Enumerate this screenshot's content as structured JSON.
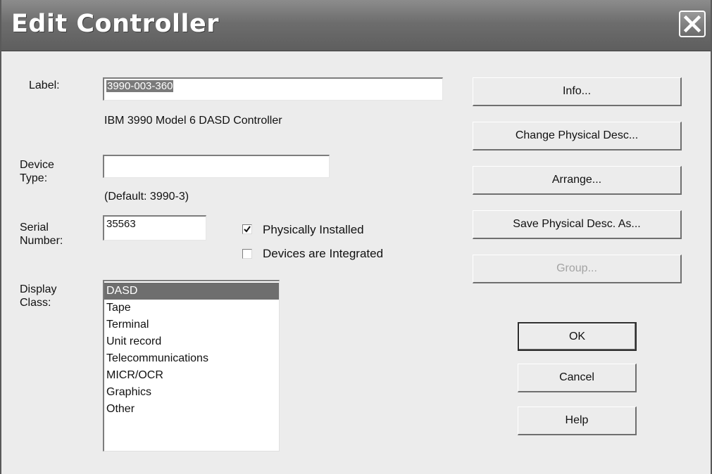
{
  "window": {
    "title": "Edit Controller"
  },
  "form": {
    "label_caption": "Label:",
    "label_value": "3990-003-360",
    "description": "IBM 3990 Model 6 DASD Controller",
    "device_type_caption_line1": "Device",
    "device_type_caption_line2": "Type:",
    "device_type_value": "",
    "device_type_default": "(Default: 3990-3)",
    "serial_caption_line1": "Serial",
    "serial_caption_line2": "Number:",
    "serial_value": "35563",
    "physically_installed_label": "Physically Installed",
    "physically_installed_checked": true,
    "devices_integrated_label": "Devices are Integrated",
    "devices_integrated_checked": false,
    "display_class_caption_line1": "Display",
    "display_class_caption_line2": "Class:",
    "display_class_items": [
      "DASD",
      "Tape",
      "Terminal",
      "Unit record",
      "Telecommunications",
      "MICR/OCR",
      "Graphics",
      "Other"
    ],
    "display_class_selected": "DASD"
  },
  "buttons": {
    "info": "Info...",
    "change_physical_desc": "Change Physical Desc...",
    "arrange": "Arrange...",
    "save_physical_desc_as": "Save Physical Desc. As...",
    "group": "Group...",
    "ok": "OK",
    "cancel": "Cancel",
    "help": "Help"
  },
  "icons": {
    "close": "close-icon",
    "check": "check-icon"
  },
  "colors": {
    "titlebar": "#6d6d6d",
    "dialog_bg": "#ececec",
    "selection": "#6e6e6e"
  }
}
